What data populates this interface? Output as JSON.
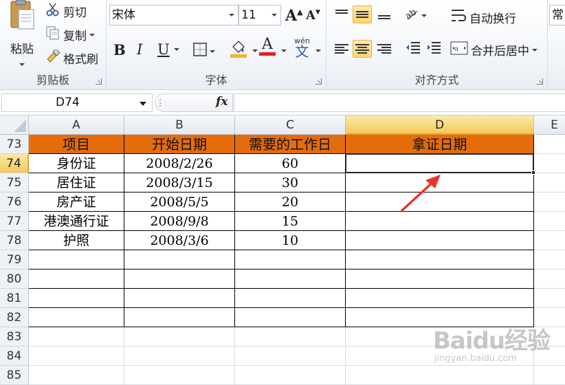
{
  "clipboard": {
    "paste_label": "粘贴",
    "cut_label": "剪切",
    "copy_label": "复制",
    "format_painter_label": "格式刷",
    "group_label": "剪贴板"
  },
  "font": {
    "family_value": "宋体",
    "size_value": "11",
    "bold_label": "B",
    "italic_label": "I",
    "underline_label": "U",
    "font_color_glyph": "A",
    "phonetic_top": "wén",
    "phonetic_char": "文",
    "grow_glyph": "A",
    "shrink_glyph": "A",
    "group_label": "字体"
  },
  "alignment": {
    "wrap_text_label": "自动换行",
    "merge_center_label": "合并后居中",
    "group_label": "对齐方式"
  },
  "number": {
    "format_value": "常"
  },
  "formula_bar": {
    "name_box_value": "D74",
    "fx_label": "fx",
    "formula_value": ""
  },
  "columns": [
    {
      "letter": "A",
      "selected": false
    },
    {
      "letter": "B",
      "selected": false
    },
    {
      "letter": "C",
      "selected": false
    },
    {
      "letter": "D",
      "selected": true
    },
    {
      "letter": "E",
      "selected": false
    }
  ],
  "rows": [
    {
      "num": "73",
      "selected": false
    },
    {
      "num": "74",
      "selected": true
    },
    {
      "num": "75",
      "selected": false
    },
    {
      "num": "76",
      "selected": false
    },
    {
      "num": "77",
      "selected": false
    },
    {
      "num": "78",
      "selected": false
    },
    {
      "num": "79",
      "selected": false
    },
    {
      "num": "80",
      "selected": false
    },
    {
      "num": "81",
      "selected": false
    },
    {
      "num": "82",
      "selected": false
    },
    {
      "num": "83",
      "selected": false
    },
    {
      "num": "84",
      "selected": false
    },
    {
      "num": "85",
      "selected": false
    }
  ],
  "table": {
    "headers": [
      "项目",
      "开始日期",
      "需要的工作日",
      "拿证日期"
    ],
    "rows": [
      [
        "身份证",
        "2008/2/26",
        "60",
        ""
      ],
      [
        "居住证",
        "2008/3/15",
        "30",
        ""
      ],
      [
        "房产证",
        "2008/5/5",
        "20",
        ""
      ],
      [
        "港澳通行证",
        "2008/9/8",
        "15",
        ""
      ],
      [
        "护照",
        "2008/3/6",
        "10",
        ""
      ],
      [
        "",
        "",
        "",
        ""
      ],
      [
        "",
        "",
        "",
        ""
      ],
      [
        "",
        "",
        "",
        ""
      ],
      [
        "",
        "",
        "",
        ""
      ]
    ],
    "header_color": "#e46c0a"
  },
  "selected_cell": "D74",
  "annotation_color": "#e8332a",
  "watermark": {
    "brand": "Baidu经验",
    "url": "jingyan.baidu.com"
  }
}
